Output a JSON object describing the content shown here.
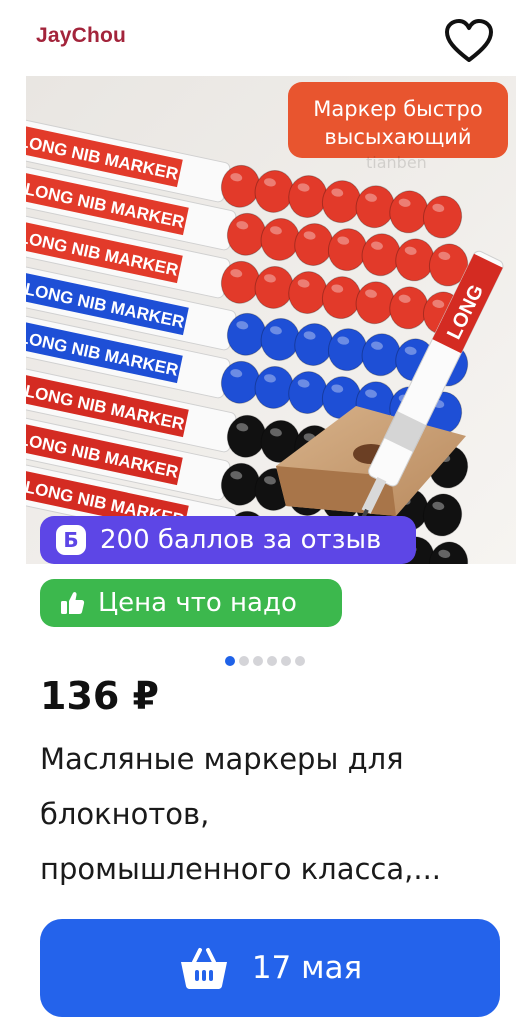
{
  "header": {
    "brand": "JayChou",
    "favorite_icon": "heart-outline-icon"
  },
  "image": {
    "overlay_text_line1": "Маркер быстро",
    "overlay_text_line2": "высыхающий",
    "marker_label": "LONG NIB MARKER",
    "watermark": "tianben",
    "marker_colors": [
      "#e23a2a",
      "#1e4fd6",
      "#111111"
    ],
    "carousel_count": 6,
    "carousel_active_index": 0
  },
  "badges": {
    "points_icon_letter": "Б",
    "points_text": "200 баллов за отзыв",
    "price_tag_icon": "thumbs-up-icon",
    "price_tag_text": "Цена что надо"
  },
  "price": "136 ₽",
  "product_title_lines": [
    "Масляные маркеры для",
    "блокнотов,",
    "промышленного класса,..."
  ],
  "cta": {
    "icon": "basket-icon",
    "label": "17 мая"
  },
  "colors": {
    "brand": "#a3243b",
    "points_badge": "#5d46e6",
    "price_badge": "#3cb84d",
    "cta": "#2463eb",
    "dot_active": "#1f62e8"
  }
}
